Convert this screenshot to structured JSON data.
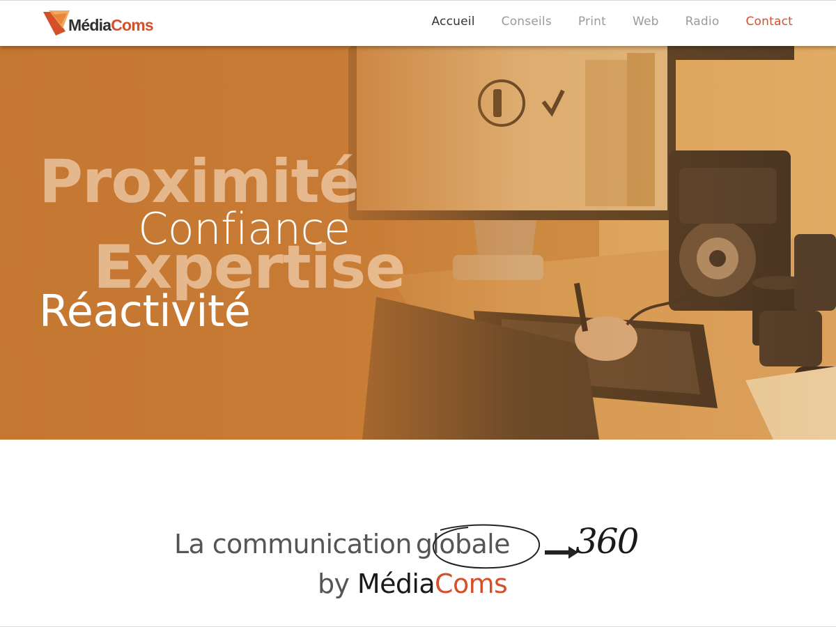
{
  "logo": {
    "name_part1": "Média",
    "name_part2": "Coms"
  },
  "nav": {
    "items": [
      {
        "label": "Accueil"
      },
      {
        "label": "Conseils"
      },
      {
        "label": "Print"
      },
      {
        "label": "Web"
      },
      {
        "label": "Radio"
      },
      {
        "label": "Contact"
      }
    ],
    "active": "Accueil"
  },
  "hero": {
    "word1": "Proximité",
    "word2": "Confiance",
    "word3": "Expertise",
    "word4": "Réactivité"
  },
  "tagline": {
    "part1": "La communication",
    "highlight": "globale",
    "annotation": "360",
    "line2_prefix": "by ",
    "line2_brand1": "Média",
    "line2_brand2": "Coms"
  },
  "colors": {
    "brand_orange": "#d4502a",
    "hero_tint": "#c77a35",
    "nav_active": "#333333",
    "nav_inactive": "#9a9a9a"
  }
}
